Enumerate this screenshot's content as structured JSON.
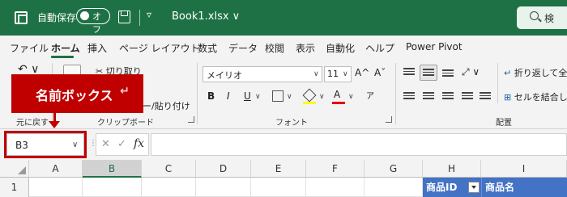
{
  "titlebar": {
    "autosave_label": "自動保存",
    "autosave_state": "オフ",
    "quick_access_more": "▿",
    "file_name": "Book1.xlsx ∨",
    "search_label": "検",
    "color": "#1e7145"
  },
  "menu": {
    "tabs": [
      "ファイル",
      "ホーム",
      "挿入",
      "ページ レイアウト",
      "数式",
      "データ",
      "校閲",
      "表示",
      "自動化",
      "ヘルプ",
      "Power Pivot"
    ],
    "active_tab": "ホーム"
  },
  "ribbon": {
    "undo": "↶ ∨",
    "clipboard": {
      "cut_label": "切り取り",
      "copy_paste_label": "ー/貼り付け",
      "group_label": "クリップボード",
      "undo_group_label": "元に戻す"
    },
    "font": {
      "name": "メイリオ",
      "size": "11",
      "grow": "A^",
      "shrink": "Aˇ",
      "bold": "B",
      "italic": "I",
      "underline": "U",
      "strikethrough": "ア",
      "font_color_letter": "A",
      "group_label": "フォント"
    },
    "alignment": {
      "wrap_text": "折り返して全",
      "merge_center": "セルを結合し",
      "group_label": "配置"
    }
  },
  "callout": {
    "text": "名前ボックス",
    "color": "#c00000"
  },
  "formula_bar": {
    "name_box_value": "B3",
    "cancel": "✕",
    "enter": "✓",
    "fx": "fx",
    "formula_value": ""
  },
  "grid": {
    "columns": [
      "A",
      "B",
      "C",
      "D",
      "E",
      "F",
      "G",
      "H",
      "I"
    ],
    "selected_column": "B",
    "row_numbers": [
      "1"
    ],
    "header_cells": [
      "商品ID",
      "商品名"
    ],
    "header_fill": "#4472c4"
  }
}
